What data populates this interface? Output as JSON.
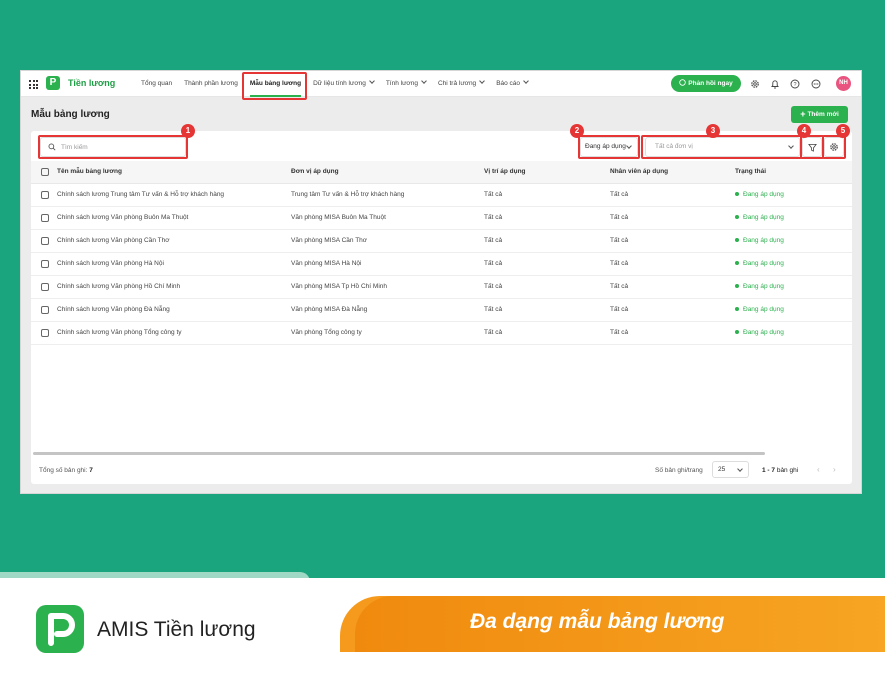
{
  "app": {
    "name": "Tiền lương",
    "logo_letter": "P"
  },
  "nav": [
    {
      "label": "Tổng quan",
      "chevron": false
    },
    {
      "label": "Thành phần lương",
      "chevron": false
    },
    {
      "label": "Mẫu bảng lương",
      "chevron": false,
      "active": true
    },
    {
      "label": "Dữ liệu tính lương",
      "chevron": true
    },
    {
      "label": "Tính lương",
      "chevron": true
    },
    {
      "label": "Chi trả lương",
      "chevron": true
    },
    {
      "label": "Báo cáo",
      "chevron": true
    }
  ],
  "header": {
    "feedback_label": "Phản hồi ngay",
    "avatar_initials": "NH"
  },
  "page": {
    "title": "Mẫu bảng lương",
    "add_label": "Thêm mới"
  },
  "filters": {
    "search_placeholder": "Tìm kiếm",
    "status_value": "Đang áp dụng",
    "unit_placeholder": "Tất cả đơn vị"
  },
  "markers": [
    "1",
    "2",
    "3",
    "4",
    "5"
  ],
  "table": {
    "columns": [
      "Tên mẫu bảng lương",
      "Đơn vị áp dụng",
      "Vị trí áp dụng",
      "Nhân viên áp dụng",
      "Trạng thái"
    ],
    "rows": [
      [
        "Chính sách lương Trung tâm Tư vấn & Hỗ trợ khách hàng",
        "Trung tâm Tư vấn & Hỗ trợ khách hàng",
        "Tất cả",
        "Tất cả",
        "Đang áp dụng"
      ],
      [
        "Chính sách lương Văn phòng Buôn Ma Thuột",
        "Văn phòng MISA Buôn Ma Thuột",
        "Tất cả",
        "Tất cả",
        "Đang áp dụng"
      ],
      [
        "Chính sách lương Văn phòng Cần Thơ",
        "Văn phòng MISA Cần Thơ",
        "Tất cả",
        "Tất cả",
        "Đang áp dụng"
      ],
      [
        "Chính sách lương Văn phòng Hà Nội",
        "Văn phòng MISA Hà Nội",
        "Tất cả",
        "Tất cả",
        "Đang áp dụng"
      ],
      [
        "Chính sách lương Văn phòng Hồ Chí Minh",
        "Văn phòng MISA Tp Hồ Chí Minh",
        "Tất cả",
        "Tất cả",
        "Đang áp dụng"
      ],
      [
        "Chính sách lương Văn phòng Đà Nẵng",
        "Văn phòng MISA Đà Nẵng",
        "Tất cả",
        "Tất cả",
        "Đang áp dụng"
      ],
      [
        "Chính sách lương Văn phòng Tổng công ty",
        "Văn phòng Tổng công ty",
        "Tất cả",
        "Tất cả",
        "Đang áp dụng"
      ]
    ]
  },
  "footer": {
    "total_label": "Tổng số bản ghi:",
    "total_value": "7",
    "per_page_label": "Số bản ghi/trang",
    "per_page_value": "25",
    "range_value": "1 - 7",
    "range_suffix": "bản ghi"
  },
  "banner": {
    "brand": "AMIS Tiền lương",
    "slogan": "Đa dạng mẫu bảng lương"
  },
  "colors": {
    "brand_green": "#2bb14e",
    "background": "#1ba57e",
    "marker_red": "#e63535",
    "banner_orange": "#f59a1c"
  }
}
